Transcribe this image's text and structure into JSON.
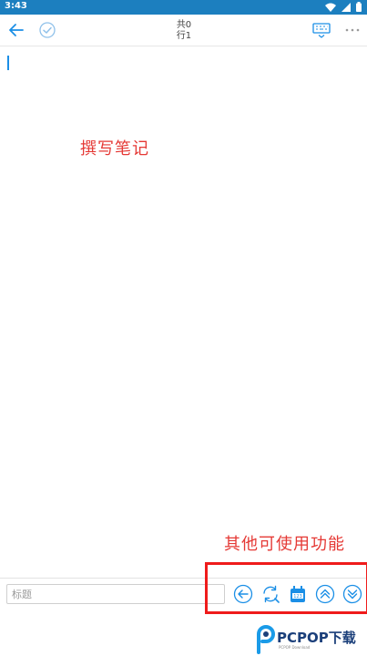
{
  "status_bar": {
    "time": "3:43"
  },
  "toolbar": {
    "counter_total": "共0",
    "counter_line": "行1"
  },
  "annotations": {
    "write_note": "撰写笔记",
    "other_functions": "其他可使用功能"
  },
  "bottom_bar": {
    "title_placeholder": "标题",
    "title_value": ""
  },
  "watermark": {
    "brand": "PCPOP下载",
    "sub": "PCPOP Download"
  },
  "colors": {
    "status_bar": "#1c7fbf",
    "accent": "#1b8fe6",
    "annotation_red": "#e53935"
  }
}
